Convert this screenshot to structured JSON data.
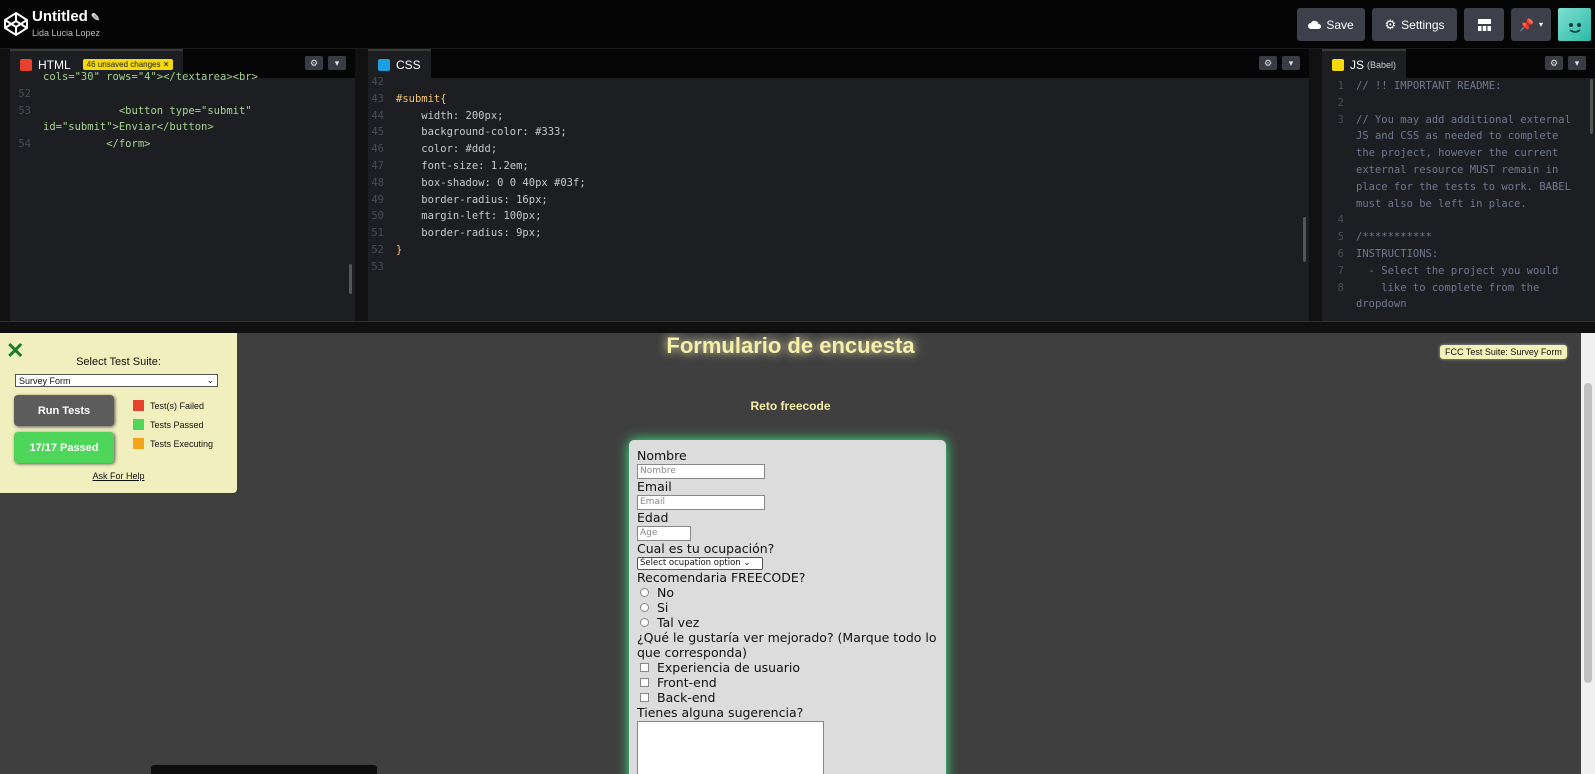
{
  "topbar": {
    "title": "Untitled",
    "author": "Lida Lucia Lopez",
    "save_label": "Save",
    "settings_label": "Settings"
  },
  "html_pane": {
    "tab_label": "HTML",
    "unsaved_badge": "46 unsaved changes",
    "lines": [
      {
        "n": "",
        "text": "cols=\"30\" rows=\"4\"></textarea><br>"
      },
      {
        "n": "52",
        "text": ""
      },
      {
        "n": "53",
        "text": "            <button type=\"submit\""
      },
      {
        "n": "",
        "text": "id=\"submit\">Enviar</button>"
      },
      {
        "n": "54",
        "text": "          </form>"
      }
    ]
  },
  "css_pane": {
    "tab_label": "CSS",
    "lines": [
      {
        "n": "42",
        "text": ""
      },
      {
        "n": "43",
        "text": "#submit{"
      },
      {
        "n": "44",
        "text": "    width: 200px;"
      },
      {
        "n": "45",
        "text": "    background-color: #333;"
      },
      {
        "n": "46",
        "text": "    color: #ddd;"
      },
      {
        "n": "47",
        "text": "    font-size: 1.2em;"
      },
      {
        "n": "48",
        "text": "    box-shadow: 0 0 40px #03f;"
      },
      {
        "n": "49",
        "text": "    border-radius: 16px;"
      },
      {
        "n": "50",
        "text": "    margin-left: 100px;"
      },
      {
        "n": "51",
        "text": "    border-radius: 9px;"
      },
      {
        "n": "52",
        "text": "}"
      },
      {
        "n": "53",
        "text": ""
      }
    ]
  },
  "js_pane": {
    "tab_label": "JS",
    "tab_sub": "(Babel)",
    "lines": [
      {
        "n": "1",
        "text": "// !! IMPORTANT README:"
      },
      {
        "n": "2",
        "text": ""
      },
      {
        "n": "3",
        "text": "// You may add additional external"
      },
      {
        "n": "",
        "text": "JS and CSS as needed to complete"
      },
      {
        "n": "",
        "text": "the project, however the current"
      },
      {
        "n": "",
        "text": "external resource MUST remain in"
      },
      {
        "n": "",
        "text": "place for the tests to work. BABEL"
      },
      {
        "n": "",
        "text": "must also be left in place."
      },
      {
        "n": "4",
        "text": ""
      },
      {
        "n": "5",
        "text": "/***********"
      },
      {
        "n": "6",
        "text": "INSTRUCTIONS:"
      },
      {
        "n": "7",
        "text": "  - Select the project you would"
      },
      {
        "n": "8",
        "text": "    like to complete from the"
      },
      {
        "n": "",
        "text": "dropdown"
      }
    ]
  },
  "preview": {
    "title": "Formulario de encuesta",
    "subtitle": "Reto freecode",
    "fcc_badge": "FCC Test Suite: Survey Form",
    "form": {
      "name_label": "Nombre",
      "name_placeholder": "Nombre",
      "email_label": "Email",
      "email_placeholder": "Email",
      "age_label": "Edad",
      "age_placeholder": "Age",
      "occupation_label": "Cual es tu ocupación?",
      "occupation_selected": "Select ocupation option",
      "recommend_label": "Recomendaria FREECODE?",
      "radio_options": [
        "No",
        "Si",
        "Tal vez"
      ],
      "improve_label": "¿Qué le gustaría ver mejorado? (Marque todo lo que corresponda)",
      "check_options": [
        "Experiencia de usuario",
        "Front-end",
        "Back-end"
      ],
      "suggestion_label": "Tienes alguna sugerencia?"
    }
  },
  "test_panel": {
    "title": "Select Test Suite:",
    "selected_suite": "Survey Form",
    "run_label": "Run Tests",
    "passed_label": "17/17 Passed",
    "legend": [
      {
        "label": "Test(s) Failed",
        "color": "#e8412d"
      },
      {
        "label": "Tests Passed",
        "color": "#4ed65a"
      },
      {
        "label": "Tests Executing",
        "color": "#f5a31a"
      }
    ],
    "help_label": "Ask For Help"
  }
}
